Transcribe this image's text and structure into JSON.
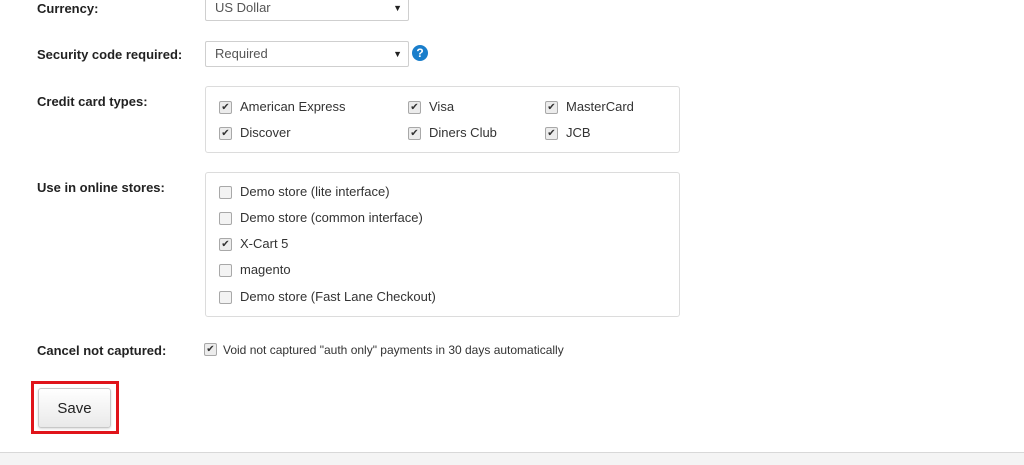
{
  "currency": {
    "label": "Currency:",
    "value": "US Dollar"
  },
  "security_code": {
    "label": "Security code required:",
    "value": "Required",
    "help": "?"
  },
  "card_types": {
    "label": "Credit card types:",
    "items": [
      {
        "label": "American Express",
        "checked": true
      },
      {
        "label": "Visa",
        "checked": true
      },
      {
        "label": "MasterCard",
        "checked": true
      },
      {
        "label": "Discover",
        "checked": true
      },
      {
        "label": "Diners Club",
        "checked": true
      },
      {
        "label": "JCB",
        "checked": true
      }
    ]
  },
  "online_stores": {
    "label": "Use in online stores:",
    "items": [
      {
        "label": "Demo store (lite interface)",
        "checked": false
      },
      {
        "label": "Demo store (common interface)",
        "checked": false
      },
      {
        "label": "X-Cart 5",
        "checked": true
      },
      {
        "label": "magento",
        "checked": false
      },
      {
        "label": "Demo store (Fast Lane Checkout)",
        "checked": false
      }
    ]
  },
  "cancel_not_captured": {
    "label": "Cancel not captured:",
    "option": "Void not captured \"auth only\" payments in 30 days automatically",
    "checked": true
  },
  "save_label": "Save",
  "colors": {
    "highlight": "#e0141a",
    "help": "#1a7ecb"
  }
}
